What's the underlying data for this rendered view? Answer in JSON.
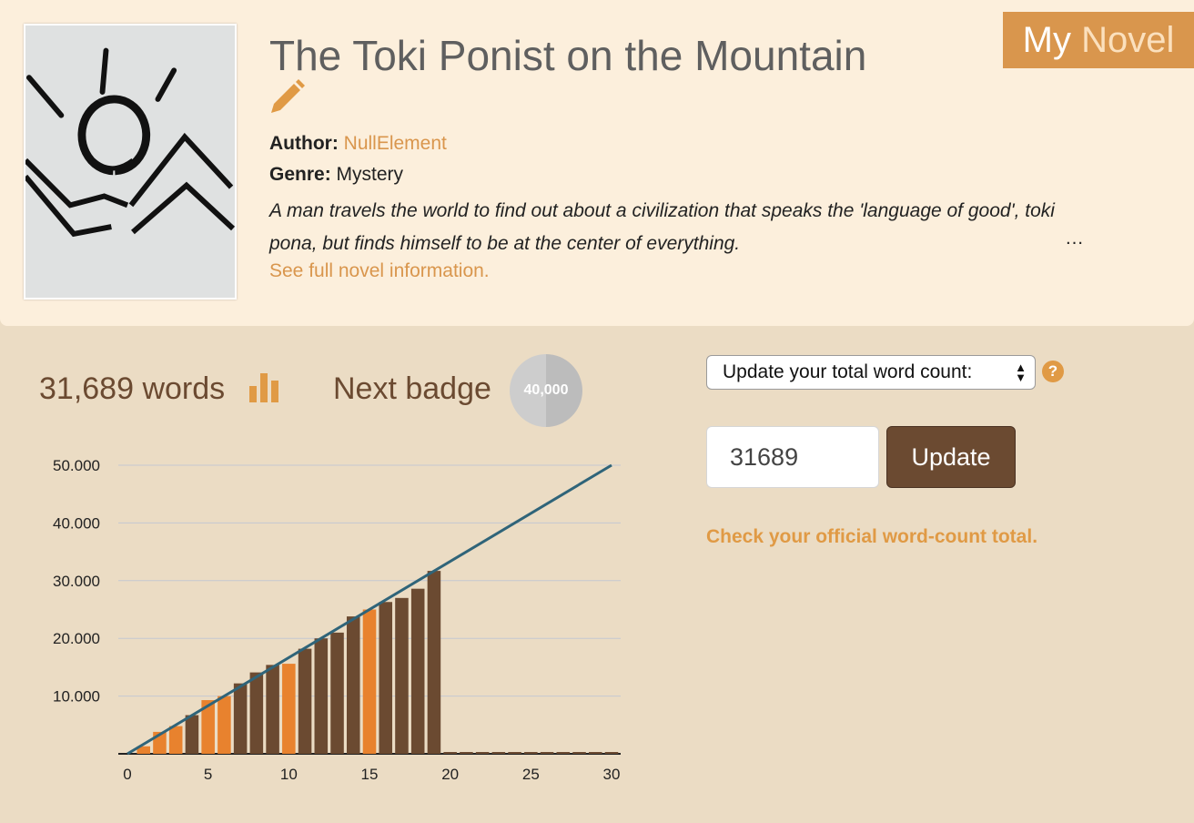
{
  "header": {
    "badge_word1": "My",
    "badge_word2": "Novel",
    "brand_colors": {
      "accent": "#d9964d",
      "accent_light": "#fbe0bd"
    }
  },
  "novel": {
    "cover_image": "hand-drawn-sun-over-mountains",
    "title": "The Toki Ponist on the Mountain",
    "author_label": "Author:",
    "author": "NullElement",
    "genre_label": "Genre:",
    "genre": "Mystery",
    "synopsis": "A man travels the world to find out about a civilization that speaks the 'language of good', toki pona, but finds himself to be at the center of everything.",
    "synopsis_ellipsis": "…",
    "see_full_link": "See full novel information."
  },
  "stats": {
    "word_count_text": "31,689 words",
    "next_badge_label": "Next badge",
    "next_badge_value": "40,000"
  },
  "update_form": {
    "mode_select_value": "Update your total word count:",
    "word_count_input": "31689",
    "update_button": "Update",
    "official_link": "Check your official word-count total.",
    "help_icon_glyph": "?"
  },
  "chart_data": {
    "type": "bar",
    "x": [
      1,
      2,
      3,
      4,
      5,
      6,
      7,
      8,
      9,
      10,
      11,
      12,
      13,
      14,
      15,
      16,
      17,
      18,
      19,
      20,
      21,
      22,
      23,
      24,
      25,
      26,
      27,
      28,
      29,
      30
    ],
    "values": [
      1300,
      3800,
      4800,
      6700,
      9300,
      10000,
      12200,
      14100,
      15400,
      15600,
      18200,
      20000,
      21000,
      23800,
      25000,
      26300,
      27000,
      28600,
      31689,
      0,
      0,
      0,
      0,
      0,
      0,
      0,
      0,
      0,
      0,
      0
    ],
    "bar_colors": [
      "#e8822e",
      "#e8822e",
      "#e8822e",
      "#6b4a31",
      "#e8822e",
      "#e8822e",
      "#6b4a31",
      "#6b4a31",
      "#6b4a31",
      "#e8822e",
      "#6b4a31",
      "#6b4a31",
      "#6b4a31",
      "#6b4a31",
      "#e8822e",
      "#6b4a31",
      "#6b4a31",
      "#6b4a31",
      "#6b4a31",
      "#6b4a31",
      "#6b4a31",
      "#6b4a31",
      "#6b4a31",
      "#6b4a31",
      "#6b4a31",
      "#6b4a31",
      "#6b4a31",
      "#6b4a31",
      "#6b4a31",
      "#6b4a31"
    ],
    "target_line": {
      "from": [
        0,
        0
      ],
      "to": [
        30,
        50000
      ],
      "color": "#2f6479"
    },
    "x_ticks": [
      0,
      5,
      10,
      15,
      20,
      25,
      30
    ],
    "x_tick_labels": [
      "0",
      "5",
      "10",
      "15",
      "20",
      "25",
      "30"
    ],
    "y_ticks": [
      10000,
      20000,
      30000,
      40000,
      50000
    ],
    "y_tick_labels": [
      "10.000",
      "20.000",
      "30.000",
      "40.000",
      "50.000"
    ],
    "xlim": [
      0,
      30
    ],
    "ylim": [
      0,
      50000
    ],
    "grid": true,
    "title": "",
    "xlabel": "",
    "ylabel": ""
  }
}
